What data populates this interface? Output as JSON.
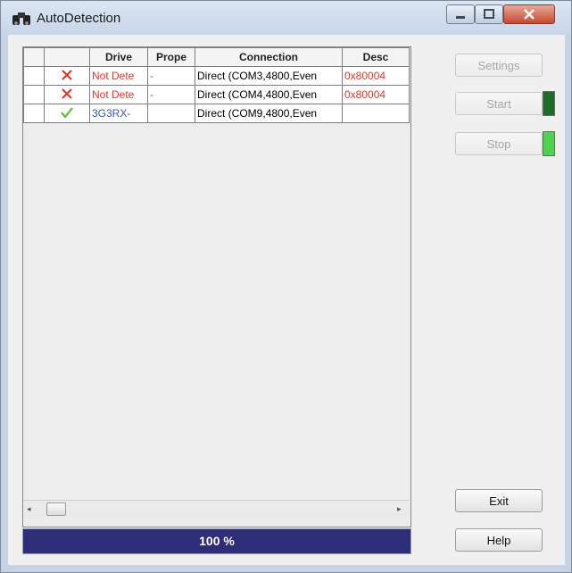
{
  "window": {
    "title": "AutoDetection"
  },
  "table": {
    "columns": [
      "",
      "",
      "Drive",
      "Prope",
      "Connection",
      "Desc"
    ],
    "rows": [
      {
        "status": "error",
        "drive": "Not Dete",
        "prope": "-",
        "connection": "Direct (COM3,4800,Even",
        "desc": "0x80004"
      },
      {
        "status": "error",
        "drive": "Not Dete",
        "prope": "-",
        "connection": "Direct (COM4,4800,Even",
        "desc": "0x80004"
      },
      {
        "status": "ok",
        "drive": "3G3RX-",
        "prope": "",
        "connection": "Direct (COM9,4800,Even",
        "desc": ""
      }
    ]
  },
  "progress": {
    "value": 100,
    "label": "100 %"
  },
  "buttons": {
    "settings": "Settings",
    "start": "Start",
    "stop": "Stop",
    "exit": "Exit",
    "help": "Help"
  },
  "scrollbar": {
    "left_arrow": "◂",
    "right_arrow": "▸"
  },
  "colors": {
    "error": "#e0392a",
    "ok": "#5bbf3b",
    "link": "#3b57b5",
    "progress": "#2e2d78",
    "start_led": "#1f6b2a",
    "stop_led": "#4ed34e"
  },
  "icons": {
    "app": "binoculars-icon",
    "error": "red-x-icon",
    "ok": "green-check-icon"
  }
}
